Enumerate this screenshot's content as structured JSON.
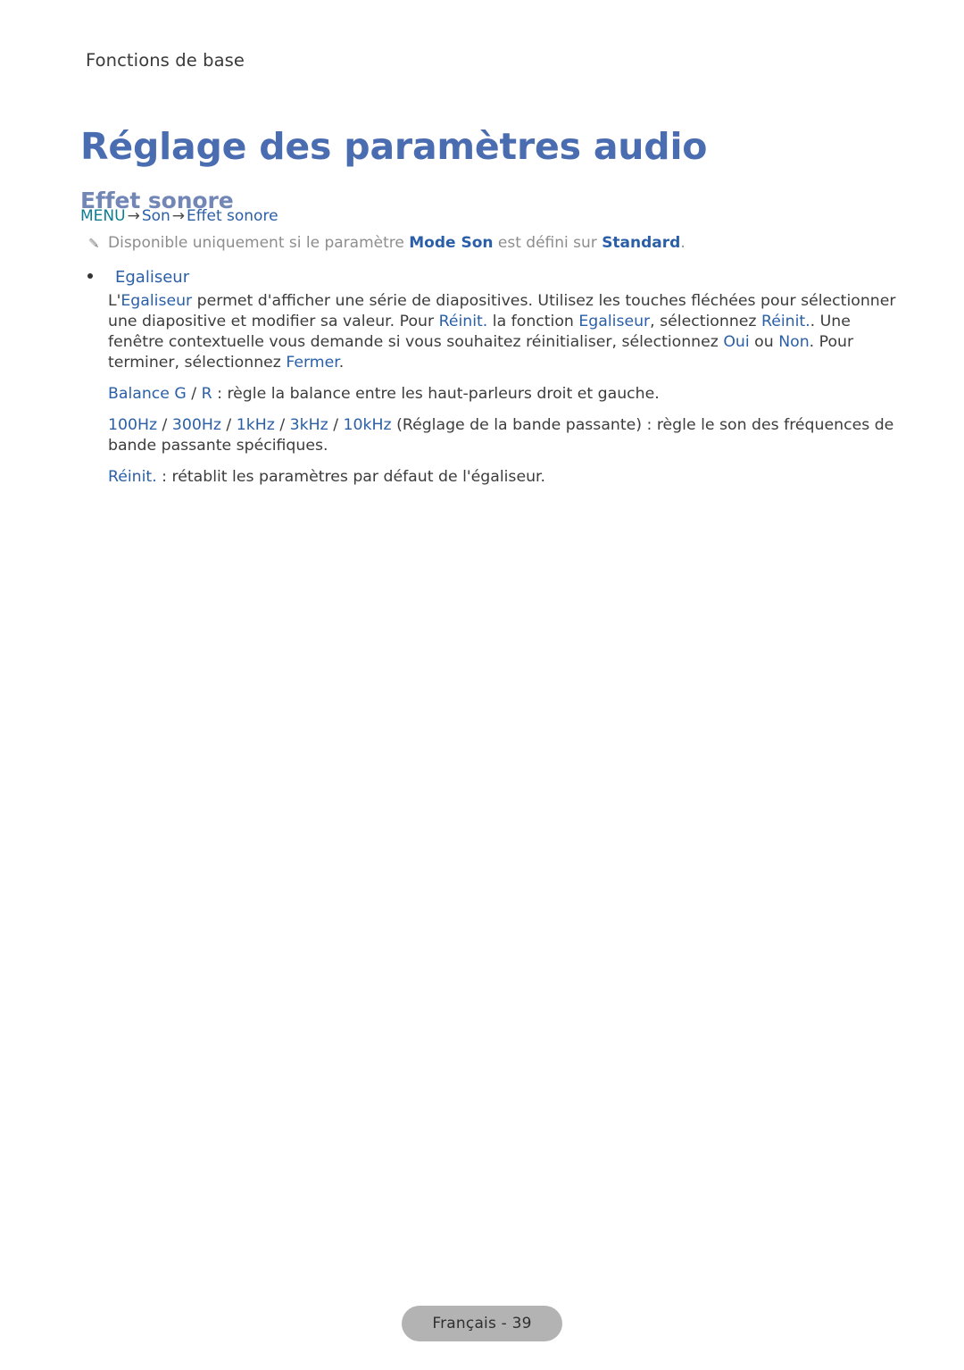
{
  "document": {
    "running_header": "Fonctions de base",
    "chapter_title": "Réglage des paramètres audio",
    "section_heading": "Effet sonore"
  },
  "colors": {
    "title_blue": "#4a6cb0",
    "heading_blue": "#7287b5",
    "link_blue": "#2a5fa8",
    "menu_teal": "#0e7d92",
    "body_gray": "#3c3c3c",
    "note_gray": "#8d8d8d",
    "footer_pill_bg": "#b3b3b3"
  },
  "menu_path": {
    "menu_label": "MENU",
    "arrow": "→",
    "items": [
      "Son",
      "Effet sonore"
    ]
  },
  "note": {
    "icon": "pencil-icon",
    "text_before": "Disponible uniquement si le paramètre ",
    "bold_1": "Mode Son",
    "text_middle": " est défini sur ",
    "bold_2": "Standard",
    "text_after": "."
  },
  "bullet": {
    "marker": "•",
    "title": "Egaliseur",
    "paragraphs": [
      {
        "id": "equalizer-description",
        "runs": [
          {
            "t": "L'",
            "style": "body"
          },
          {
            "t": "Egaliseur",
            "style": "link"
          },
          {
            "t": " permet d'afficher une série de diapositives. Utilisez les touches fléchées pour sélectionner une diapositive et modifier sa valeur. Pour ",
            "style": "body"
          },
          {
            "t": "Réinit.",
            "style": "link"
          },
          {
            "t": " la fonction ",
            "style": "body"
          },
          {
            "t": "Egaliseur",
            "style": "link"
          },
          {
            "t": ", sélectionnez ",
            "style": "body"
          },
          {
            "t": "Réinit.",
            "style": "link"
          },
          {
            "t": ". Une fenêtre contextuelle vous demande si vous souhaitez réinitialiser, sélectionnez ",
            "style": "body"
          },
          {
            "t": "Oui",
            "style": "link"
          },
          {
            "t": " ou ",
            "style": "body"
          },
          {
            "t": "Non",
            "style": "link"
          },
          {
            "t": ". Pour terminer, sélectionnez ",
            "style": "body"
          },
          {
            "t": "Fermer",
            "style": "link"
          },
          {
            "t": ".",
            "style": "body"
          }
        ]
      },
      {
        "id": "balance-description",
        "runs": [
          {
            "t": "Balance G",
            "style": "link"
          },
          {
            "t": " / ",
            "style": "body"
          },
          {
            "t": "R",
            "style": "link"
          },
          {
            "t": " : règle la balance entre les haut-parleurs droit et gauche.",
            "style": "body"
          }
        ]
      },
      {
        "id": "band-description",
        "runs": [
          {
            "t": "100Hz",
            "style": "link"
          },
          {
            "t": " / ",
            "style": "body"
          },
          {
            "t": "300Hz",
            "style": "link"
          },
          {
            "t": " / ",
            "style": "body"
          },
          {
            "t": "1kHz",
            "style": "link"
          },
          {
            "t": " / ",
            "style": "body"
          },
          {
            "t": "3kHz",
            "style": "link"
          },
          {
            "t": " / ",
            "style": "body"
          },
          {
            "t": "10kHz",
            "style": "link"
          },
          {
            "t": " (Réglage de la bande passante) : règle le son des fréquences de bande passante spécifiques.",
            "style": "body"
          }
        ]
      },
      {
        "id": "reset-description",
        "runs": [
          {
            "t": "Réinit.",
            "style": "link"
          },
          {
            "t": " : rétablit les paramètres par défaut de l'égaliseur.",
            "style": "body"
          }
        ]
      }
    ]
  },
  "footer": {
    "label": "Français - 39"
  }
}
